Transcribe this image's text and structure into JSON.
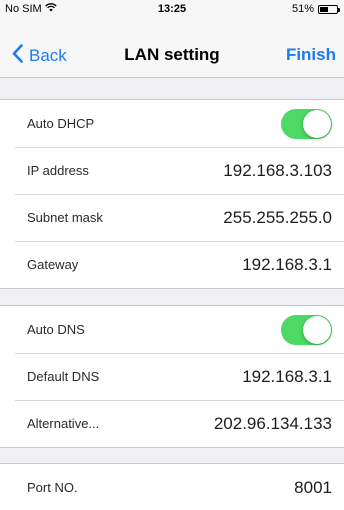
{
  "status_bar": {
    "carrier": "No SIM",
    "wifi_icon": "wifi-icon",
    "time": "13:25",
    "battery": "51%",
    "battery_level": 0.51
  },
  "nav": {
    "back_label": "Back",
    "back_icon": "chevron-left-icon",
    "title": "LAN setting",
    "finish_label": "Finish",
    "accent": "#1a7cf5"
  },
  "network": {
    "auto_dhcp": {
      "label": "Auto DHCP",
      "on": true
    },
    "ip_address": {
      "label": "IP address",
      "value": "192.168.3.103"
    },
    "subnet_mask": {
      "label": "Subnet mask",
      "value": "255.255.255.0"
    },
    "gateway": {
      "label": "Gateway",
      "value": "192.168.3.1"
    }
  },
  "dns": {
    "auto_dns": {
      "label": "Auto DNS",
      "on": true
    },
    "default_dns": {
      "label": "Default DNS",
      "value": "192.168.3.1"
    },
    "alternative": {
      "label": "Alternative...",
      "value": "202.96.134.133"
    }
  },
  "port": {
    "label": "Port NO.",
    "value": "8001"
  },
  "toggle_color": "#4cd964"
}
